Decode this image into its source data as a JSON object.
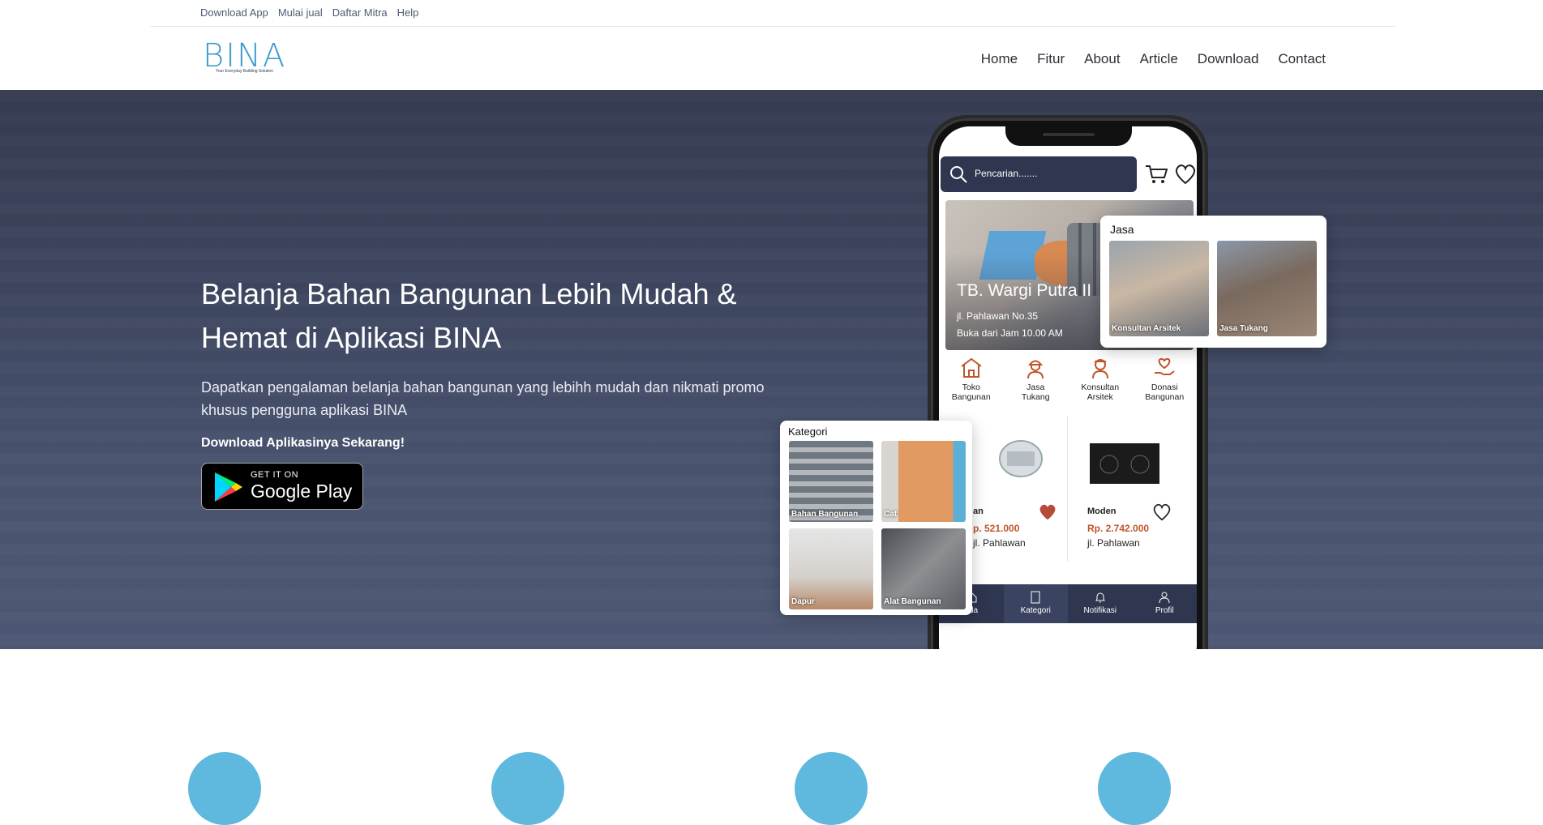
{
  "topbar": {
    "links": [
      "Download App",
      "Mulai jual",
      "Daftar Mitra",
      "Help"
    ]
  },
  "header": {
    "logo_text": "BINA",
    "logo_tagline": "Your Everyday Building Solution",
    "nav": [
      "Home",
      "Fitur",
      "About",
      "Article",
      "Download",
      "Contact"
    ]
  },
  "hero": {
    "title": "Belanja Bahan Bangunan Lebih Mudah & Hemat di Aplikasi BINA",
    "subtitle": "Dapatkan pengalaman belanja bahan bangunan yang lebihh mudah dan nikmati promo khusus pengguna aplikasi BINA",
    "cta": "Download Aplikasinya Sekarang!",
    "google_play": {
      "small": "GET IT ON",
      "big": "Google Play"
    }
  },
  "phone": {
    "search_placeholder": "Pencarian.......",
    "banner": {
      "store": "TB. Wargi Putra II",
      "address": "jl. Pahlawan No.35",
      "hours": "Buka dari Jam 10.00 AM"
    },
    "categories": [
      {
        "line1": "Toko",
        "line2": "Bangunan"
      },
      {
        "line1": "Jasa",
        "line2": "Tukang"
      },
      {
        "line1": "Konsultan",
        "line2": "Arsitek"
      },
      {
        "line1": "Donasi",
        "line2": "Bangunan"
      }
    ],
    "products": [
      {
        "name": "an",
        "price": "p. 521.000",
        "location": "jl. Pahlawan"
      },
      {
        "name": "Moden",
        "price": "Rp. 2.742.000",
        "location": "jl. Pahlawan"
      }
    ],
    "bottom_nav": [
      "nda",
      "Kategori",
      "Notifikasi",
      "Profil"
    ]
  },
  "jasa_card": {
    "title": "Jasa",
    "tiles": [
      "Konsultan Arsitek",
      "Jasa Tukang"
    ]
  },
  "kategori_card": {
    "title": "Kategori",
    "tiles": [
      "Bahan Bangunan",
      "Cat",
      "Dapur",
      "Alat Bangunan"
    ]
  },
  "colors": {
    "hero_bg": "#3e4660",
    "accent_blue": "#3d9bd1",
    "app_navy": "#2e3650",
    "price_red": "#c0552b",
    "feature_circle": "#5fb8de"
  }
}
